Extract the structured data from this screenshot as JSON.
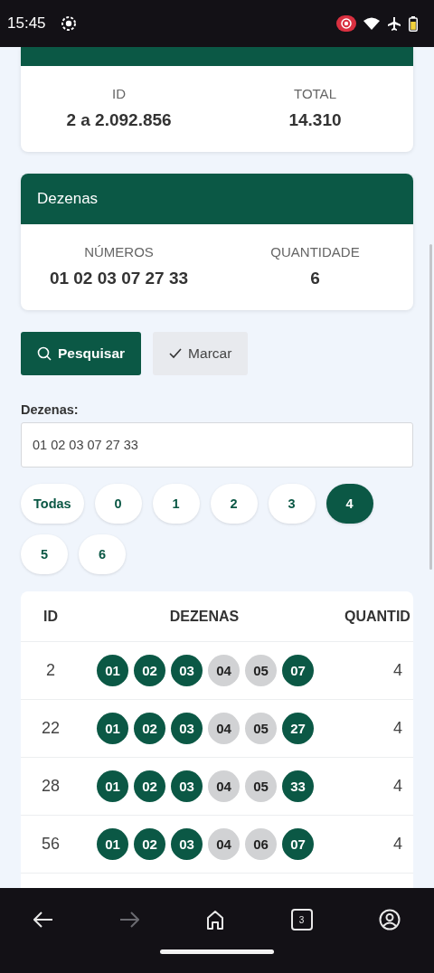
{
  "status_bar": {
    "time": "15:45"
  },
  "info_card": {
    "stats": [
      {
        "label": "ID",
        "value": "2 a 2.092.856"
      },
      {
        "label": "TOTAL",
        "value": "14.310"
      }
    ]
  },
  "dezenas_card": {
    "title": "Dezenas",
    "stats": [
      {
        "label": "NÚMEROS",
        "value": "01 02 03 07 27 33"
      },
      {
        "label": "QUANTIDADE",
        "value": "6"
      }
    ]
  },
  "buttons": [
    {
      "kind": "primary",
      "label": "Pesquisar"
    },
    {
      "kind": "secondary",
      "label": "Marcar"
    }
  ],
  "field": {
    "label": "Dezenas:",
    "value": "01 02 03 07 27 33"
  },
  "filters": [
    {
      "label": "Todas",
      "selected": false
    },
    {
      "label": "0",
      "selected": false
    },
    {
      "label": "1",
      "selected": false
    },
    {
      "label": "2",
      "selected": false
    },
    {
      "label": "3",
      "selected": false
    },
    {
      "label": "4",
      "selected": true
    },
    {
      "label": "5",
      "selected": false
    },
    {
      "label": "6",
      "selected": false
    }
  ],
  "table": {
    "columns": [
      "ID",
      "DEZENAS",
      "QUANTID"
    ],
    "rows": [
      {
        "id": "2",
        "numbers": [
          {
            "n": "01",
            "hit": true
          },
          {
            "n": "02",
            "hit": true
          },
          {
            "n": "03",
            "hit": true
          },
          {
            "n": "04",
            "hit": false
          },
          {
            "n": "05",
            "hit": false
          },
          {
            "n": "07",
            "hit": true
          }
        ],
        "count": "4"
      },
      {
        "id": "22",
        "numbers": [
          {
            "n": "01",
            "hit": true
          },
          {
            "n": "02",
            "hit": true
          },
          {
            "n": "03",
            "hit": true
          },
          {
            "n": "04",
            "hit": false
          },
          {
            "n": "05",
            "hit": false
          },
          {
            "n": "27",
            "hit": true
          }
        ],
        "count": "4"
      },
      {
        "id": "28",
        "numbers": [
          {
            "n": "01",
            "hit": true
          },
          {
            "n": "02",
            "hit": true
          },
          {
            "n": "03",
            "hit": true
          },
          {
            "n": "04",
            "hit": false
          },
          {
            "n": "05",
            "hit": false
          },
          {
            "n": "33",
            "hit": true
          }
        ],
        "count": "4"
      },
      {
        "id": "56",
        "numbers": [
          {
            "n": "01",
            "hit": true
          },
          {
            "n": "02",
            "hit": true
          },
          {
            "n": "03",
            "hit": true
          },
          {
            "n": "04",
            "hit": false
          },
          {
            "n": "06",
            "hit": false
          },
          {
            "n": "07",
            "hit": true
          }
        ],
        "count": "4"
      }
    ]
  },
  "nav_bar": {
    "forward_disabled": true,
    "tab_count": "3"
  }
}
